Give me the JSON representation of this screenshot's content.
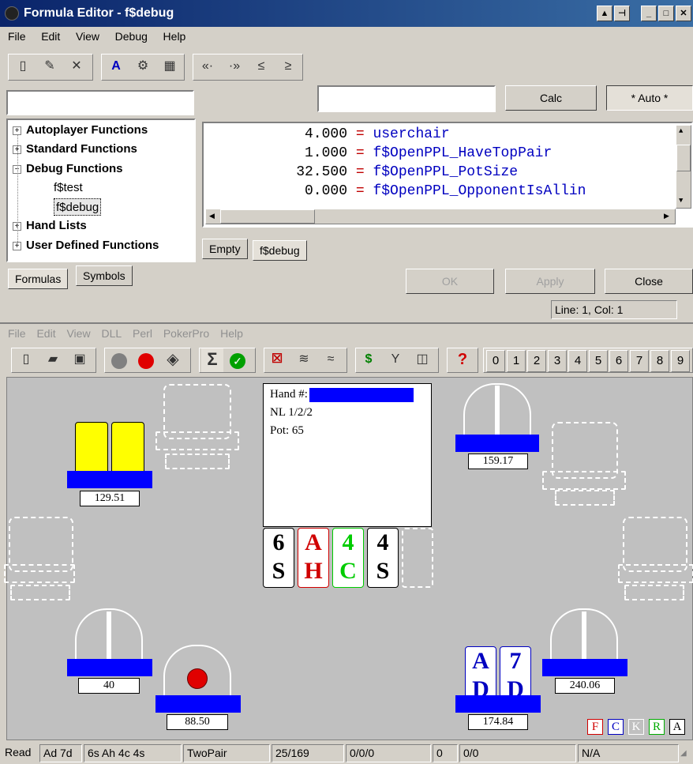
{
  "editor": {
    "title": "Formula Editor - f$debug",
    "menu": [
      "File",
      "Edit",
      "View",
      "Debug",
      "Help"
    ],
    "search_value": "",
    "calc_value": "",
    "calc_label": "Calc",
    "auto_label": "* Auto *",
    "tree": [
      {
        "label": "Autoplayer Functions",
        "expanded": false
      },
      {
        "label": "Standard Functions",
        "expanded": false
      },
      {
        "label": "Debug Functions",
        "expanded": true
      },
      {
        "label": "f$test",
        "child": true
      },
      {
        "label": "f$debug",
        "child": true,
        "selected": true
      },
      {
        "label": "Hand Lists",
        "expanded": false
      },
      {
        "label": "User Defined Functions",
        "expanded": false
      }
    ],
    "debug_lines": [
      {
        "value": "4.000",
        "eq": "=",
        "name": "userchair"
      },
      {
        "value": "1.000",
        "eq": "=",
        "name": "f$OpenPPL_HaveTopPair"
      },
      {
        "value": "32.500",
        "eq": "=",
        "name": "f$OpenPPL_PotSize"
      },
      {
        "value": "0.000",
        "eq": "=",
        "name": "f$OpenPPL_OpponentIsAllin"
      }
    ],
    "left_tabs": [
      "Formulas",
      "Symbols"
    ],
    "code_tabs": [
      "Empty",
      "f$debug"
    ],
    "ok_label": "OK",
    "apply_label": "Apply",
    "close_label": "Close",
    "cursor_pos": "Line: 1, Col: 1"
  },
  "main": {
    "menu": [
      "File",
      "Edit",
      "View",
      "DLL",
      "Perl",
      "PokerPro",
      "Help"
    ],
    "chair_buttons": [
      "0",
      "1",
      "2",
      "3",
      "4",
      "5",
      "6",
      "7",
      "8",
      "9"
    ],
    "help_icon": "?"
  },
  "table": {
    "info_hand": "Hand #:",
    "info_blinds": "NL 1/2/2",
    "info_pot": "Pot: 65",
    "board": [
      {
        "rank": "6",
        "suit": "S",
        "color": "#000000"
      },
      {
        "rank": "A",
        "suit": "H",
        "color": "#d00000"
      },
      {
        "rank": "4",
        "suit": "C",
        "color": "#00cc00"
      },
      {
        "rank": "4",
        "suit": "S",
        "color": "#000000"
      }
    ],
    "stacks": {
      "left_top": "129.51",
      "right_top": "159.17",
      "left_bottom": "40",
      "bottom_mid": "88.50",
      "bottom_right": "174.84",
      "right_bottom": "240.06"
    },
    "hero_cards": [
      {
        "rank": "A",
        "suit": "D"
      },
      {
        "rank": "7",
        "suit": "D"
      }
    ],
    "flags": [
      {
        "letter": "F",
        "color": "#d00000"
      },
      {
        "letter": "C",
        "color": "#0000c0"
      },
      {
        "letter": "K",
        "color": "#ffffff"
      },
      {
        "letter": "R",
        "color": "#00aa00"
      },
      {
        "letter": "A",
        "color": "#000000"
      }
    ]
  },
  "status": {
    "state": "Read",
    "hole": "Ad 7d",
    "board": "6s Ah 4c 4s",
    "hand": "TwoPair",
    "rank": "25/169",
    "counts": "0/0/0",
    "zero": "0",
    "counts2": "0/0",
    "na": "N/A"
  }
}
